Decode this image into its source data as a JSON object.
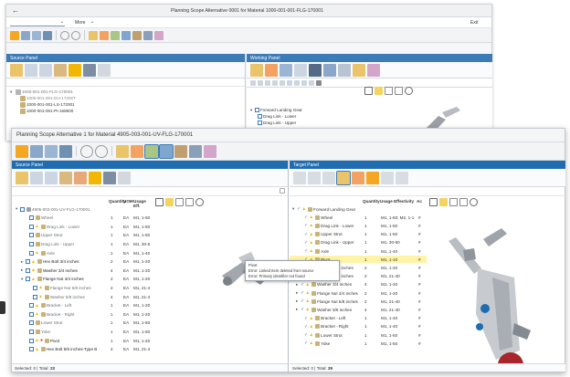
{
  "back": {
    "title": "Planning Scope Alternative 0001 for Material 1000-001-001-FLG-170001",
    "more": "More",
    "exit": "Exit"
  },
  "back_source": {
    "title": "Source Panel",
    "tree": [
      "1000-001-001-FLG-170001",
      "1000-001-001-DU-17200T",
      "1000-001-001-LS-172001",
      "1000-001-001-PI-168600"
    ]
  },
  "back_working": {
    "title": "Working Panel",
    "tree": [
      "Forward Landing Gear",
      "Drag Link - Lower",
      "Drag Link - Upper"
    ]
  },
  "front": {
    "title": "Planning Scope Alternative 1 for Material 4905-003-001-UV-FLG-170001"
  },
  "source": {
    "title": "Source Panel",
    "headers": {
      "qty": "Quantity",
      "uom": "UOM",
      "usage": "Usage Eff."
    },
    "rows": [
      {
        "label": "4905-003-001-UV-FLG-170001",
        "qty": "",
        "uom": "",
        "usage": ""
      },
      {
        "label": "Wheel",
        "qty": "1",
        "uom": "EA",
        "usage": "M1, 1-50"
      },
      {
        "label": "Drag Link - Lower",
        "qty": "1",
        "uom": "EA",
        "usage": "M1, 1-50"
      },
      {
        "label": "Upper Strut",
        "qty": "1",
        "uom": "EA",
        "usage": "M1, 1-50"
      },
      {
        "label": "Drag Link - Upper",
        "qty": "1",
        "uom": "EA",
        "usage": "M1, 30-5"
      },
      {
        "label": "Axle",
        "qty": "1",
        "uom": "EA",
        "usage": "M1, 1-40"
      },
      {
        "label": "Hex Bolt 3/4 inches",
        "qty": "2",
        "uom": "EA",
        "usage": "M1, 1-20"
      },
      {
        "label": "Washer 3/4 inches",
        "qty": "4",
        "uom": "EA",
        "usage": "M1, 1-20"
      },
      {
        "label": "Flange Nut 3/4 inches",
        "qty": "2",
        "uom": "EA",
        "usage": "M1, 1-20"
      },
      {
        "label": "Flange Nut 5/8 inches",
        "qty": "2",
        "uom": "EA",
        "usage": "M1, 21-4"
      },
      {
        "label": "Washer 5/8 inches",
        "qty": "4",
        "uom": "EA",
        "usage": "M1, 21-4"
      },
      {
        "label": "Bracket - Left",
        "qty": "1",
        "uom": "EA",
        "usage": "M1, 1-20"
      },
      {
        "label": "Bracket - Right",
        "qty": "1",
        "uom": "EA",
        "usage": "M1, 1-20"
      },
      {
        "label": "Lower Strut",
        "qty": "1",
        "uom": "EA",
        "usage": "M1, 1-50"
      },
      {
        "label": "Yoke",
        "qty": "1",
        "uom": "EA",
        "usage": "M1, 1-50"
      },
      {
        "label": "Pivot",
        "qty": "1",
        "uom": "EA",
        "usage": "M1, 1-20"
      },
      {
        "label": "Hex Bolt 5/8 inches-Type B",
        "qty": "4",
        "uom": "EA",
        "usage": "M1, 21-4"
      }
    ],
    "footer": {
      "selected_label": "Selected:",
      "selected": "0",
      "total_label": "Total:",
      "total": "23"
    }
  },
  "tooltip": {
    "lines": [
      "Pivot",
      "Error: Linked Item deleted from source",
      "Error: Primary identifier not found"
    ]
  },
  "target": {
    "title": "Target Panel",
    "headers": {
      "qty": "Quantity",
      "usage": "Usage Effectivity",
      "extra": "Ac"
    },
    "rows": [
      {
        "label": "Forward Landing Gear",
        "qty": "",
        "usage": "",
        "extra": ""
      },
      {
        "label": "Wheel",
        "qty": "1",
        "usage": "M1, 1-50; M2, 1-1",
        "extra": "#"
      },
      {
        "label": "Drag Link - Lower",
        "qty": "1",
        "usage": "M1, 1-50",
        "extra": "#"
      },
      {
        "label": "Upper Strut",
        "qty": "1",
        "usage": "M1, 1-50",
        "extra": "#"
      },
      {
        "label": "Drag Link - Upper",
        "qty": "1",
        "usage": "M1, 30-50",
        "extra": "#"
      },
      {
        "label": "Axle",
        "qty": "1",
        "usage": "M1, 1-40",
        "extra": "#"
      },
      {
        "label": "Pivot",
        "qty": "1",
        "usage": "M1, 1-10",
        "extra": "#"
      },
      {
        "label": "Hex Bolt 3/4 inches",
        "qty": "2",
        "usage": "M1, 1-20",
        "extra": "#"
      },
      {
        "label": "Hex Bolt 5/8 inches",
        "qty": "2",
        "usage": "M1, 21-40",
        "extra": "#"
      },
      {
        "label": "Washer 3/4 inches",
        "qty": "4",
        "usage": "M1, 1-20",
        "extra": "#"
      },
      {
        "label": "Flange Nut 3/4 inches",
        "qty": "2",
        "usage": "M1, 1-20",
        "extra": "#"
      },
      {
        "label": "Flange Nut 5/8 inches",
        "qty": "2",
        "usage": "M1, 21-40",
        "extra": "#"
      },
      {
        "label": "Washer 5/8 inches",
        "qty": "4",
        "usage": "M1, 21-40",
        "extra": "#"
      },
      {
        "label": "Bracket - Left",
        "qty": "1",
        "usage": "M1, 1-40",
        "extra": "#"
      },
      {
        "label": "Bracket - Right",
        "qty": "1",
        "usage": "M1, 1-40",
        "extra": "#"
      },
      {
        "label": "Lower Strut",
        "qty": "1",
        "usage": "M1, 1-50",
        "extra": "#"
      },
      {
        "label": "Yoke",
        "qty": "1",
        "usage": "M1, 1-50",
        "extra": "#"
      }
    ],
    "footer": {
      "selected_label": "Selected:",
      "selected": "0",
      "total_label": "Total:",
      "total": "29"
    }
  },
  "colors": {
    "header_blue": "#3d7ab8",
    "panel_blue": "#1f6cb0",
    "warning": "#f2b705",
    "error": "#d9342b",
    "save": "#f5a623",
    "check": "#3a7bbd"
  },
  "icons": [
    "save-icon",
    "undo-icon",
    "redo-icon",
    "warning-icon",
    "eye-icon",
    "search-icon",
    "link-icon",
    "checkbox-icon"
  ]
}
